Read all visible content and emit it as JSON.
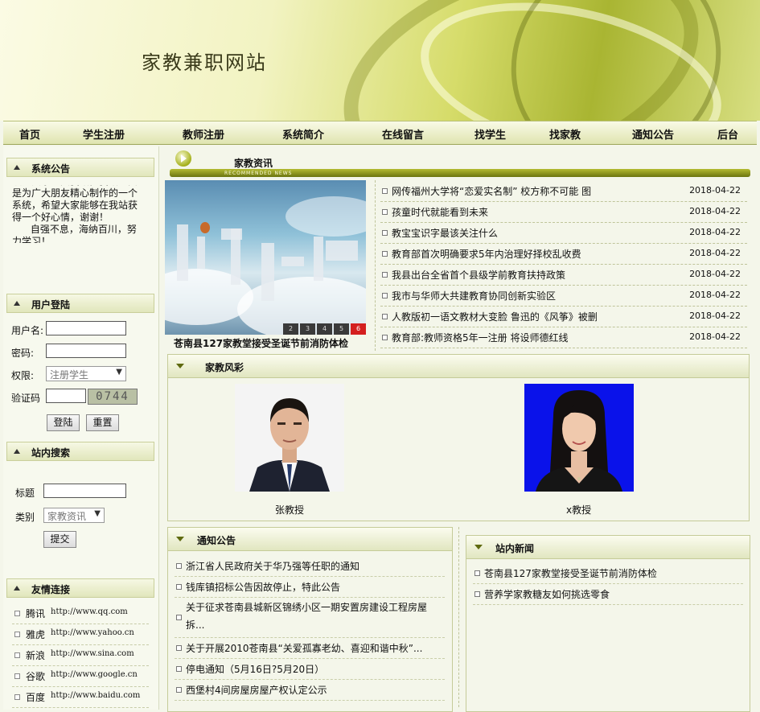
{
  "header": {
    "site_title": "家教兼职网站"
  },
  "nav": {
    "items": [
      "首页",
      "学生注册",
      "教师注册",
      "系统简介",
      "在线留言",
      "找学生",
      "找家教",
      "通知公告",
      "后台"
    ]
  },
  "sidebar": {
    "notice": {
      "title": "系统公告",
      "text": "欢迎大家登陆我站，我站主要是为广大朋友精心制作的一个系统，希望大家能够在我站获得一个好心情，谢谢！\n      自强不息，海纳百川，努力学习！"
    },
    "login": {
      "title": "用户登陆",
      "username_label": "用户名:",
      "password_label": "密码:",
      "role_label": "权限:",
      "role_value": "注册学生",
      "captcha_label": "验证码",
      "captcha_code": "0744",
      "login_button": "登陆",
      "reset_button": "重置"
    },
    "search": {
      "title": "站内搜索",
      "keyword_label": "标题",
      "category_label": "类别",
      "category_value": "家教资讯",
      "submit_button": "提交"
    },
    "links": {
      "title": "友情连接",
      "items": [
        {
          "name": "腾讯",
          "url": "http://www.qq.com"
        },
        {
          "name": "雅虎",
          "url": "http://www.yahoo.cn"
        },
        {
          "name": "新浪",
          "url": "http://www.sina.com"
        },
        {
          "name": "谷歌",
          "url": "http://www.google.cn"
        },
        {
          "name": "百度",
          "url": "http://www.baidu.com"
        }
      ]
    }
  },
  "news": {
    "title": "家教资讯",
    "subtitle": "RECOMMENDED NEWS",
    "slide_caption": "苍南县127家教堂接受圣诞节前消防体检",
    "slide_pages": [
      "2",
      "3",
      "4",
      "5",
      "6"
    ],
    "items": [
      {
        "title": "网传福州大学将“恋爱实名制” 校方称不可能 图",
        "date": "2018-04-22"
      },
      {
        "title": "孩童时代就能看到未来",
        "date": "2018-04-22"
      },
      {
        "title": "教宝宝识字最该关注什么",
        "date": "2018-04-22"
      },
      {
        "title": "教育部首次明确要求5年内治理好择校乱收费",
        "date": "2018-04-22"
      },
      {
        "title": "我县出台全省首个县级学前教育扶持政策",
        "date": "2018-04-22"
      },
      {
        "title": "我市与华师大共建教育协同创新实验区",
        "date": "2018-04-22"
      },
      {
        "title": "人教版初一语文教材大变脸 鲁迅的《风筝》被删",
        "date": "2018-04-22"
      },
      {
        "title": "教育部:教师资格5年一注册 将设师德红线",
        "date": "2018-04-22"
      }
    ]
  },
  "style_panel": {
    "title": "家教风彩",
    "teachers": [
      {
        "name": "张教授"
      },
      {
        "name": "x教授"
      }
    ]
  },
  "notices": {
    "title": "通知公告",
    "items": [
      "浙江省人民政府关于华乃强等任职的通知",
      "钱库镇招标公告因故停止，特此公告",
      "关于征求苍南县城新区锦绣小区一期安置房建设工程房屋拆...",
      "关于开展2010苍南县“关爱孤寡老幼、喜迎和谐中秋”...",
      "停电通知（5月16日?5月20日）",
      "西堡村4间房屋房屋产权认定公示"
    ]
  },
  "site_news": {
    "title": "站内新闻",
    "items": [
      "苍南县127家教堂接受圣诞节前消防体检",
      "营养学家教糖友如何挑选零食"
    ]
  }
}
